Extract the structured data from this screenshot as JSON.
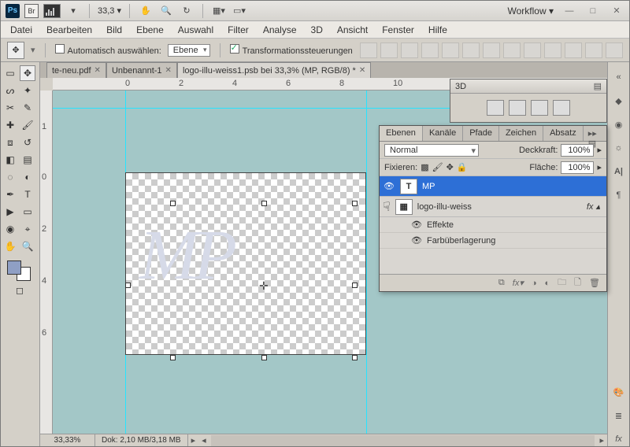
{
  "titlebar": {
    "ps": "Ps",
    "br": "Br",
    "zoom": "33,3",
    "zoom_suffix": " ▾",
    "workflow": "Workflow ▾"
  },
  "menu": [
    "Datei",
    "Bearbeiten",
    "Bild",
    "Ebene",
    "Auswahl",
    "Filter",
    "Analyse",
    "3D",
    "Ansicht",
    "Fenster",
    "Hilfe"
  ],
  "optionsbar": {
    "auto_select": "Automatisch auswählen:",
    "auto_select_target": "Ebene",
    "transform_controls": "Transformationssteuerungen"
  },
  "tabs": [
    {
      "label": "te-neu.pdf",
      "active": false,
      "closable": true
    },
    {
      "label": "Unbenannt-1",
      "active": false,
      "closable": true
    },
    {
      "label": "logo-illu-weiss1.psb bei 33,3% (MP, RGB/8) *",
      "active": true,
      "closable": true
    }
  ],
  "ruler_h": [
    "0",
    "2",
    "4",
    "6",
    "8",
    "10"
  ],
  "ruler_v": [
    "1",
    "0",
    "2",
    "4",
    "6"
  ],
  "canvas_text": "MP",
  "status": {
    "zoom": "33,33%",
    "dok": "Dok: 2,10 MB/3,18 MB"
  },
  "panel3d": {
    "title": "3D"
  },
  "layers_panel": {
    "tabs": [
      "Ebenen",
      "Kanäle",
      "Pfade",
      "Zeichen",
      "Absatz"
    ],
    "active_tab": "Ebenen",
    "blend_mode": "Normal",
    "opacity_label": "Deckkraft:",
    "opacity": "100%",
    "lock_label": "Fixieren:",
    "fill_label": "Fläche:",
    "fill": "100%",
    "layers": [
      {
        "name": "MP",
        "type": "T",
        "selected": true,
        "visible": true
      },
      {
        "name": "logo-illu-weiss",
        "type": "smart",
        "selected": false,
        "visible": true,
        "fx": true
      }
    ],
    "effects_label": "Effekte",
    "effect_name": "Farbüberlagerung"
  }
}
